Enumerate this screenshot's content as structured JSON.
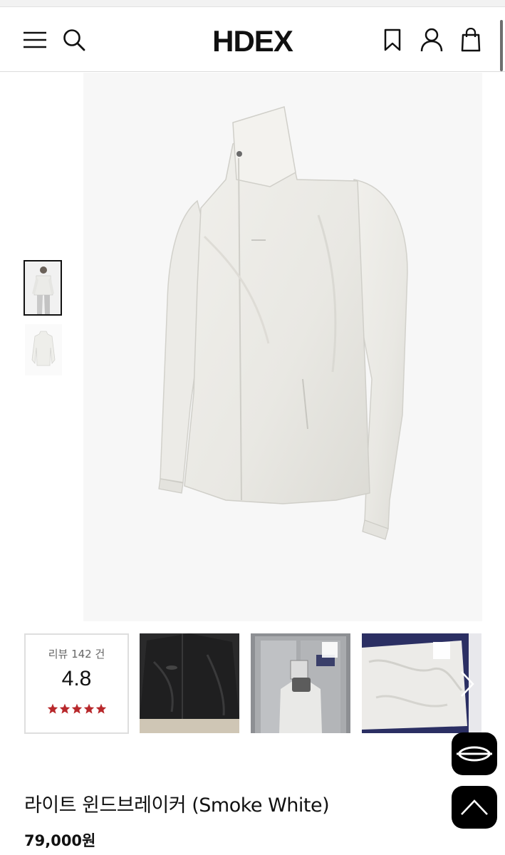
{
  "header": {
    "logo": "HDEX",
    "icons": [
      "menu-icon",
      "search-icon",
      "bookmark-icon",
      "user-icon",
      "shopping-bag-icon"
    ]
  },
  "gallery": {
    "thumbnail_count": 2,
    "active_thumbnail": 1
  },
  "reviews": {
    "label": "리뷰 142 건",
    "score": "4.8",
    "stars": 5,
    "star_color": "#b8282b"
  },
  "product": {
    "name": "라이트 윈드브레이커 (Smoke White)",
    "price": "79,000원"
  },
  "colors": {
    "fab_background": "#000000",
    "divider": "#dcdcdc"
  }
}
